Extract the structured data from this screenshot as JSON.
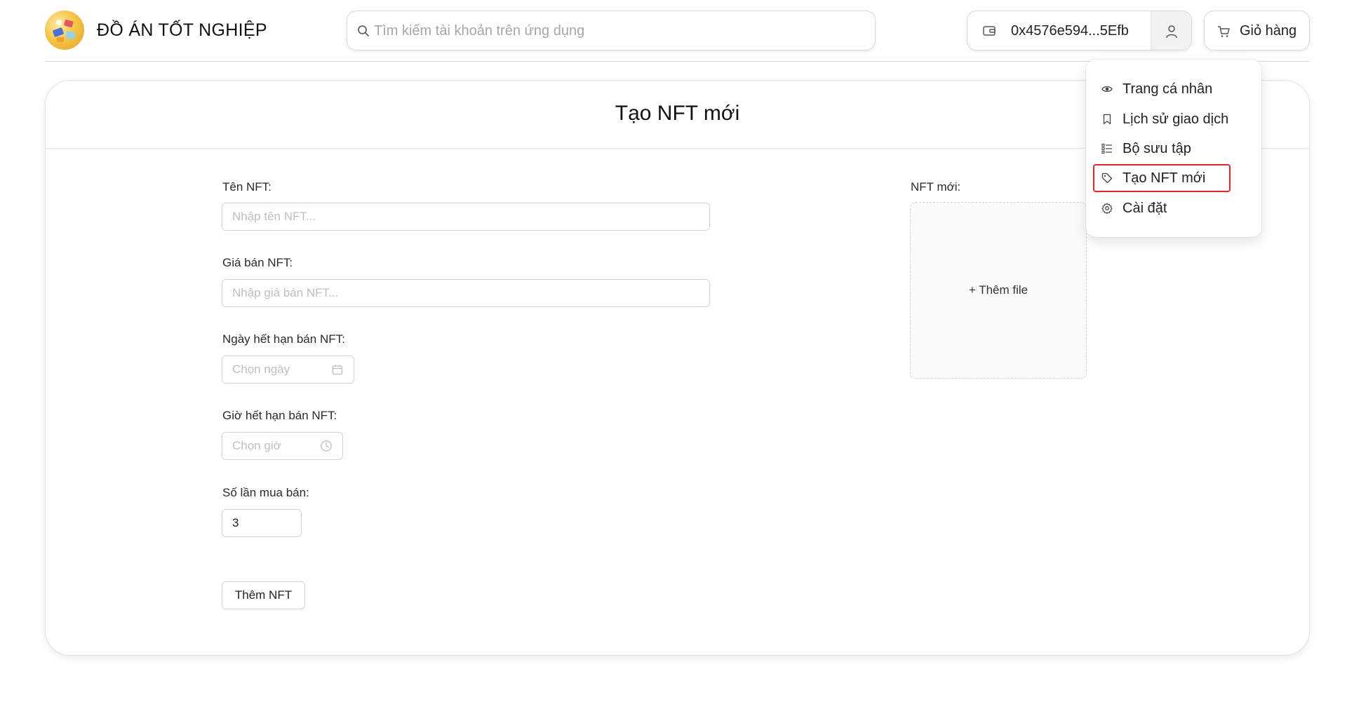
{
  "header": {
    "app_title": "ĐỒ ÁN TỐT NGHIỆP",
    "search_placeholder": "Tìm kiếm tài khoản trên ứng dụng",
    "wallet_address": "0x4576e594...5Efb",
    "cart_label": "Giỏ hàng"
  },
  "user_menu": {
    "items": [
      {
        "label": "Trang cá nhân",
        "icon": "eye-icon"
      },
      {
        "label": "Lịch sử giao dịch",
        "icon": "bookmark-icon"
      },
      {
        "label": "Bộ sưu tập",
        "icon": "list-icon"
      },
      {
        "label": "Tạo NFT mới",
        "icon": "tag-icon",
        "highlighted": true
      },
      {
        "label": "Cài đặt",
        "icon": "gear-icon"
      }
    ],
    "highlight_color": "#e0262b"
  },
  "form": {
    "title": "Tạo NFT mới",
    "name_label": "Tên NFT:",
    "name_placeholder": "Nhập tên NFT...",
    "price_label": "Giá bán NFT:",
    "price_placeholder": "Nhập giá bán NFT...",
    "date_label": "Ngày hết hạn bán NFT:",
    "date_placeholder": "Chọn ngày",
    "time_label": "Giờ hết hạn bán NFT:",
    "time_placeholder": "Chọn giờ",
    "count_label": "Số lần mua bán:",
    "count_value": "3",
    "submit_label": "Thêm NFT",
    "preview_label": "NFT mới:",
    "upload_label": "+ Thêm file"
  }
}
